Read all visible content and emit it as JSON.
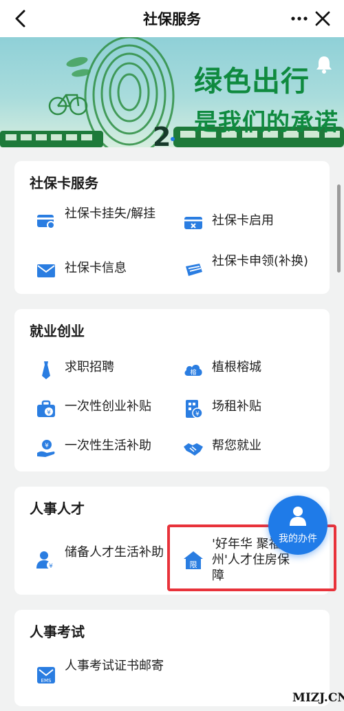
{
  "header": {
    "title": "社保服务"
  },
  "banner": {
    "headline": "绿色出行",
    "subline": "是我们的承诺",
    "page_indicator": "2"
  },
  "sections": [
    {
      "title": "社保卡服务",
      "items": [
        {
          "label": "社保卡挂失/解挂",
          "icon": "card-lock-icon"
        },
        {
          "label": "社保卡启用",
          "icon": "card-activate-icon"
        },
        {
          "label": "社保卡信息",
          "icon": "envelope-icon"
        },
        {
          "label": "社保卡申领(补换)",
          "icon": "card-apply-icon"
        }
      ]
    },
    {
      "title": "就业创业",
      "items": [
        {
          "label": "求职招聘",
          "icon": "tie-icon"
        },
        {
          "label": "植根榕城",
          "icon": "cloud-banyan-icon"
        },
        {
          "label": "一次性创业补贴",
          "icon": "briefcase-yuan-icon"
        },
        {
          "label": "场租补贴",
          "icon": "building-yuan-icon"
        },
        {
          "label": "一次性生活补助",
          "icon": "hand-yuan-icon"
        },
        {
          "label": "帮您就业",
          "icon": "handshake-icon"
        }
      ]
    },
    {
      "title": "人事人才",
      "items": [
        {
          "label": "储备人才生活补助",
          "icon": "person-yuan-icon"
        },
        {
          "label": "'好年华 聚福州'人才住房保障",
          "icon": "house-limit-icon",
          "icon_text": "限"
        }
      ]
    },
    {
      "title": "人事考试",
      "items": [
        {
          "label": "人事考试证书邮寄",
          "icon": "ems-mail-icon",
          "icon_text": "EMS"
        }
      ]
    }
  ],
  "floating_button": {
    "label": "我的办件"
  },
  "watermark": "MIZJ.CN",
  "colors": {
    "accent_blue": "#2a7de1",
    "highlight_red": "#e8323a",
    "banner_green": "#0f8a3f"
  }
}
